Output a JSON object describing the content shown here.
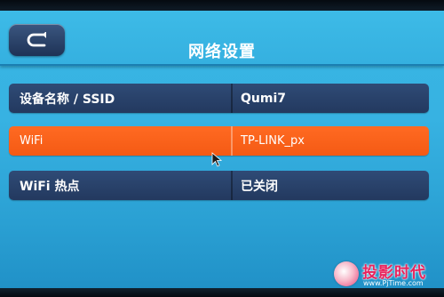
{
  "header": {
    "title": "网络设置",
    "back_icon": "back-arrow-icon"
  },
  "settings": [
    {
      "label": "设备名称 / SSID",
      "value": "Qumi7",
      "selected": false
    },
    {
      "label": "WiFi",
      "value": "TP-LINK_px",
      "selected": true
    },
    {
      "label": "WiFi 热点",
      "value": "已关闭",
      "selected": false
    }
  ],
  "watermark": {
    "brand": "投影时代",
    "url": "www.PjTime.com"
  },
  "colors": {
    "background": "#37b2e2",
    "row": "#2a4470",
    "row_selected": "#f8621a",
    "back_button": "#2c4570",
    "watermark": "#e8245d"
  }
}
